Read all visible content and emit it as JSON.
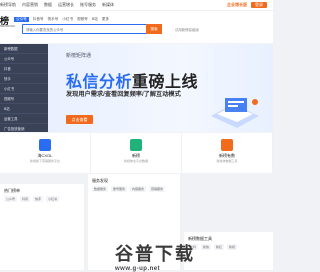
{
  "topbar": {
    "nav": [
      "新榜导航",
      "内容营销",
      "数据",
      "运营增长",
      "账号服务",
      "新媒体"
    ],
    "right_highlight": "企业增长版",
    "right_btn": "登录"
  },
  "header": {
    "logo_text": "榜",
    "logo_sub": "NEWRANK",
    "tabs": [
      "公众号",
      "抖音号",
      "快手号",
      "小红书",
      "视频号",
      "B站",
      "更多"
    ],
    "search_placeholder": "请输入你要查找的公众号",
    "search_button": "搜索",
    "hint": "试用新榜高级版"
  },
  "sidemenu": {
    "items": [
      "新榜数据",
      "公众号",
      "抖音",
      "快手",
      "小红书",
      "视频号",
      "B站",
      "运营工具",
      "广告投放营销"
    ]
  },
  "banner": {
    "tag": "新榜矩阵通",
    "headline_blue": "私信分析",
    "headline_dark": "重磅上线",
    "subline": "发现用户需求/查看回复频率/了解互动模式",
    "cta": "点击查看"
  },
  "cards": [
    {
      "name": "海CXOL",
      "desc": "新榜旗下营销服务平台",
      "color": "#2a6cf2"
    },
    {
      "name": "新榜",
      "desc": "新媒体全平台数据",
      "color": "#1fb37a"
    },
    {
      "name": "新榜有数",
      "desc": "新媒体数据工具",
      "color": "#f26b1d"
    }
  ],
  "panels": {
    "left_title": "热门榜单",
    "left_chips": [
      "公众号",
      "抖音",
      "快手",
      "小红书"
    ],
    "mid_title": "服务发现",
    "mid_chips": [
      "数据服务",
      "账号服务",
      "内容服务",
      "营销服务"
    ],
    "right_title": "新榜数据工具",
    "right_chips": [
      "新抖",
      "新快",
      "新红",
      "新视"
    ]
  },
  "watermark": {
    "main": "谷普下载",
    "sub": "www.g-up.net"
  }
}
